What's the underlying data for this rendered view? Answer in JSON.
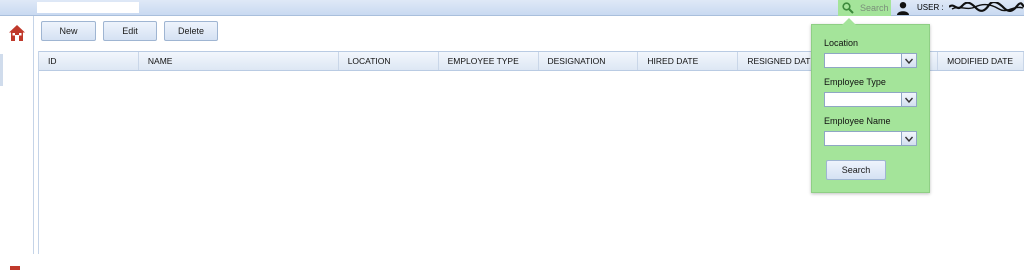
{
  "topbar": {
    "search_label": "Search",
    "user_label": "USER :",
    "icons": {
      "search": "magnifier-icon",
      "user": "user-icon"
    },
    "accent_color": "#a4e49a"
  },
  "sidebar": {
    "home_icon": "home-icon"
  },
  "toolbar": {
    "new_label": "New",
    "edit_label": "Edit",
    "delete_label": "Delete"
  },
  "grid": {
    "columns": [
      "ID",
      "NAME",
      "LOCATION",
      "EMPLOYEE TYPE",
      "DESIGNATION",
      "HIRED DATE",
      "RESIGNED DATE",
      "",
      "MODIFIED DATE"
    ],
    "rows": []
  },
  "search_panel": {
    "location_label": "Location",
    "location_value": "",
    "employee_type_label": "Employee Type",
    "employee_type_value": "",
    "employee_name_label": "Employee Name",
    "employee_name_value": "",
    "search_button_label": "Search"
  }
}
